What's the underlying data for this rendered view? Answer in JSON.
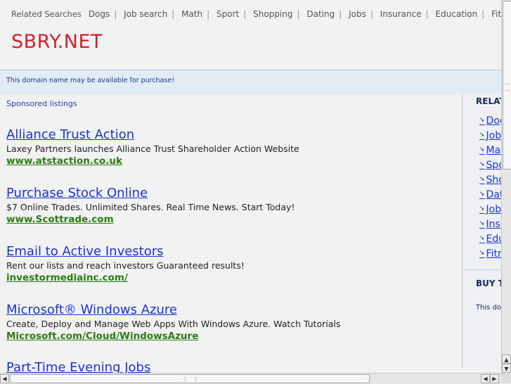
{
  "topbar": {
    "label": "Related Searches",
    "links": [
      "Dogs",
      "Job search",
      "Math",
      "Sport",
      "Shopping",
      "Dating",
      "Jobs",
      "Insurance",
      "Education",
      "Fitness"
    ]
  },
  "logo": "SBRY.NET",
  "availability_notice": "This domain name may be available for purchase!",
  "sponsored_label": "Sponsored listings",
  "listings": [
    {
      "title": "Alliance Trust Action",
      "desc": "Laxey Partners launches Alliance Trust Shareholder Action Website",
      "url": "www.atstaction.co.uk"
    },
    {
      "title": "Purchase Stock Online",
      "desc": "$7 Online Trades. Unlimited Shares. Real Time News. Start Today!",
      "url": "www.Scottrade.com"
    },
    {
      "title": "Email to Active Investors",
      "desc": "Rent our lists and reach investors Guaranteed results!",
      "url": "investormediainc.com/"
    },
    {
      "title": "Microsoft® Windows Azure",
      "desc": "Create, Deploy and Manage Web Apps With Windows Azure. Watch Tutorials",
      "url": "Microsoft.com/Cloud/WindowsAzure"
    },
    {
      "title": "Part-Time Evening Jobs",
      "desc": "",
      "url": ""
    }
  ],
  "right": {
    "related_head": "RELATED SEARCHES",
    "items": [
      "Dogs",
      "Job search",
      "Math",
      "Sport",
      "Shopping",
      "Dating",
      "Jobs",
      "Insurance",
      "Education",
      "Fitness"
    ],
    "buy_head": "BUY THIS DOMAIN",
    "buy_text": "This domain"
  },
  "scrollbar_icons": {
    "up": "arrow-up-icon",
    "down": "arrow-down-icon",
    "left": "arrow-left-icon",
    "right": "arrow-right-icon"
  }
}
